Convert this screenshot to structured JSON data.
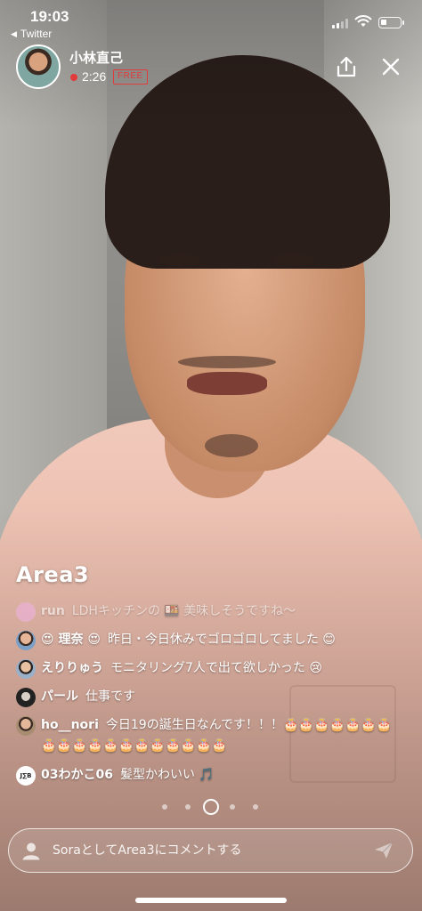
{
  "status_bar": {
    "time": "19:03",
    "back_app_label": "Twitter"
  },
  "broadcaster": {
    "name": "小林直己",
    "elapsed": "2:26",
    "badge": "FREE"
  },
  "room": {
    "name": "Area3"
  },
  "comments": [
    {
      "name": "run",
      "text": "LDHキッチンの 🍱 美味しそうですね〜",
      "avatar_color": "#f2b3e6",
      "faded": true
    },
    {
      "name": "😍 理奈 😍",
      "text": "昨日・今日休みでゴロゴロしてました 😊",
      "avatar_color": "#c98a6a",
      "faded": false
    },
    {
      "name": "えりりゅう",
      "text": "モニタリング7人で出て欲しかった 😢",
      "avatar_color": "#9ab0c8",
      "faded": false
    },
    {
      "name": "パール",
      "text": "仕事です",
      "avatar_color": "#333333",
      "faded": false
    },
    {
      "name": "ho__nori",
      "text": "今日19の誕生日なんです！！！🎂🎂🎂🎂🎂🎂🎂🎂🎂🎂🎂🎂🎂🎂🎂🎂🎂🎂🎂",
      "avatar_color": "#a98d72",
      "faded": false
    },
    {
      "name": "03わかこ06",
      "text": "髪型かわいい 🎵",
      "avatar_color": "#ffffff",
      "avatar_text": "J∑B",
      "faded": false
    }
  ],
  "page_dots": {
    "count": 5,
    "active_index": 2
  },
  "input": {
    "placeholder": "SoraとしてArea3にコメントする"
  },
  "colors": {
    "live_red": "#e23b3b",
    "shirt_pink": "#ebbcad"
  },
  "icons": {
    "back": "back-triangle-icon",
    "share": "share-icon",
    "close": "close-icon",
    "send": "send-icon",
    "user": "user-silhouette-icon"
  }
}
